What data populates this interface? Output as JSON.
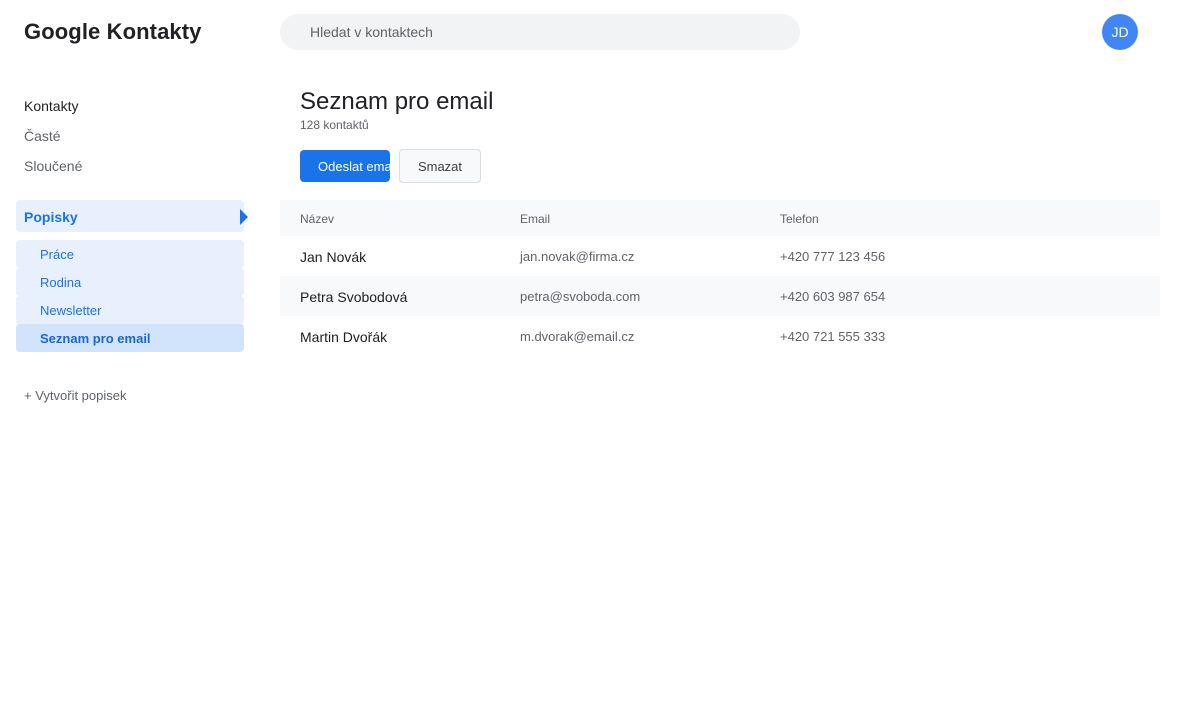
{
  "app": {
    "title": "Google Kontakty"
  },
  "search": {
    "placeholder": "Hledat v kontaktech"
  },
  "user": {
    "initials": "JD",
    "avatar_color": "#4285f4"
  },
  "sidebar": {
    "nav": [
      {
        "label": "Kontakty",
        "active": true
      },
      {
        "label": "Časté",
        "active": false
      },
      {
        "label": "Sloučené",
        "active": false
      }
    ],
    "labels_header": "Popisky",
    "labels": [
      {
        "label": "Práce",
        "selected": false
      },
      {
        "label": "Rodina",
        "selected": false
      },
      {
        "label": "Newsletter",
        "selected": false
      },
      {
        "label": "Seznam pro email",
        "selected": true
      }
    ],
    "create_label": "+ Vytvořit popisek"
  },
  "main": {
    "title": "Seznam pro email",
    "count": "128 kontaktů",
    "actions": {
      "send_email": "Odeslat email",
      "delete": "Smazat"
    },
    "table": {
      "columns": [
        "Název",
        "Email",
        "Telefon"
      ],
      "rows": [
        {
          "name": "Jan Novák",
          "email": "jan.novak@firma.cz",
          "phone": "+420 777 123 456"
        },
        {
          "name": "Petra Svobodová",
          "email": "petra@svoboda.com",
          "phone": "+420 603 987 654"
        },
        {
          "name": "Martin Dvořák",
          "email": "m.dvorak@email.cz",
          "phone": "+420 721 555 333"
        }
      ]
    }
  },
  "colors": {
    "accent": "#1a73e8",
    "label_bg": "#e8f0fe",
    "label_selected_bg": "#d2e3fc"
  }
}
